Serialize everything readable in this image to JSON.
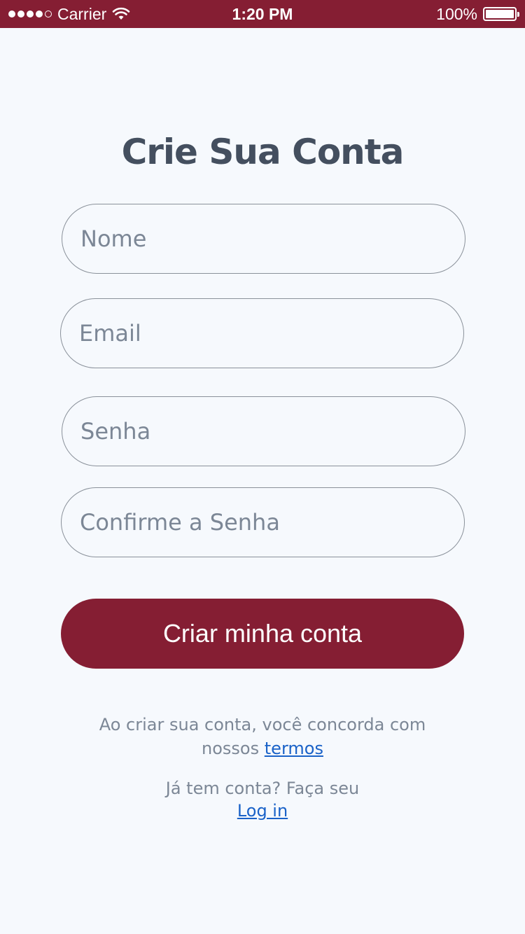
{
  "status_bar": {
    "carrier": "Carrier",
    "time": "1:20 PM",
    "battery": "100%",
    "signal_bars_filled": 4,
    "signal_bars_total": 5,
    "battery_level_percent": 100,
    "background_color": "#851e33",
    "wifi_icon": "wifi-icon",
    "battery_icon": "battery-icon"
  },
  "signup": {
    "title": "Crie Sua Conta",
    "name_placeholder": "Nome",
    "email_placeholder": "Email",
    "password_placeholder": "Senha",
    "confirm_password_placeholder": "Confirme a Senha",
    "submit_label": "Criar minha conta",
    "submit_color": "#851e33"
  },
  "footer": {
    "terms_line1": "Ao criar sua conta, você concorda com",
    "terms_line2_prefix": "nossos",
    "terms_link": "termos",
    "login_prompt": "Já tem conta? Faça seu",
    "login_link": "Log in",
    "link_color": "#1a62c8"
  }
}
